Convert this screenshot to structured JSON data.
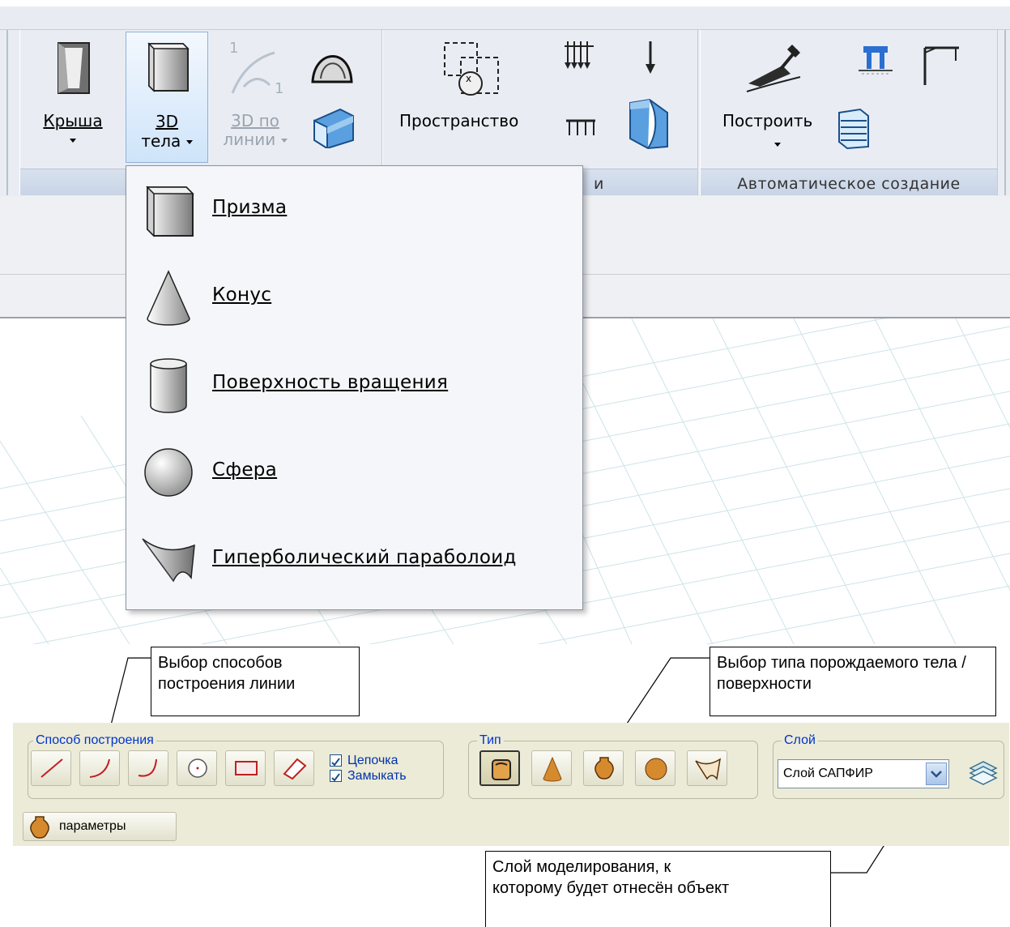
{
  "ribbon": {
    "buttons": {
      "roof": "Крыша",
      "solids_line1": "3D",
      "solids_line2": "тела",
      "along_line1": "3D по",
      "along_line2": "линии",
      "space": "Пространство",
      "build": "Построить"
    },
    "groups": {
      "group2_title_fragment": "и",
      "auto_title": "Автоматическое создание"
    },
    "along_superscript": "1",
    "along_subscript": "1"
  },
  "dropdown": {
    "items": [
      {
        "label": "Призма",
        "icon": "prism-icon"
      },
      {
        "label": "Конус",
        "icon": "cone-icon"
      },
      {
        "label": "Поверхность вращения",
        "icon": "cylinder-icon"
      },
      {
        "label": "Сфера",
        "icon": "sphere-icon"
      },
      {
        "label": "Гиперболический параболоид",
        "icon": "hyperbolic-paraboloid-icon"
      }
    ]
  },
  "callouts": {
    "line_method_1": "Выбор способов",
    "line_method_2": "построения линии",
    "body_type": "Выбор типа порождаемого тела / поверхности",
    "layer_1": "Слой моделирования, к",
    "layer_2": "которому будет отнесён объект"
  },
  "panel": {
    "method_legend": "Способ построения",
    "chain_label": "Цепочка",
    "chain_checked": true,
    "close_label": "Замыкать",
    "close_checked": true,
    "type_legend": "Тип",
    "layer_legend": "Слой",
    "layer_value": "Слой САПФИР",
    "params_label": "параметры"
  }
}
